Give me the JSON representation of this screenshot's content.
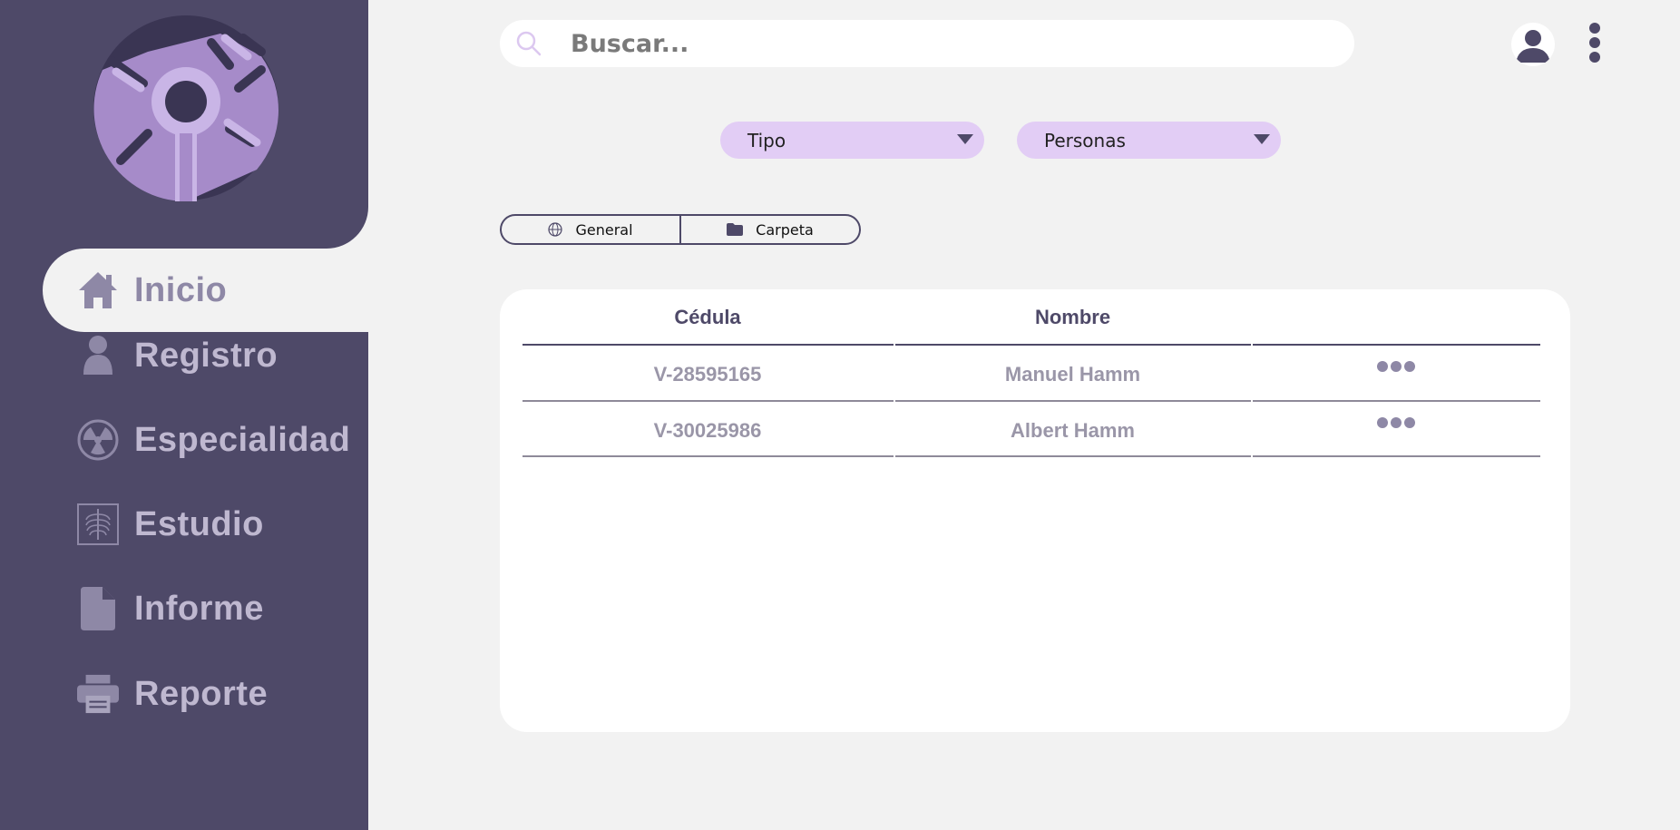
{
  "sidebar": {
    "items": [
      {
        "label": "Inicio",
        "icon": "home-icon",
        "active": true
      },
      {
        "label": "Registro",
        "icon": "user-icon"
      },
      {
        "label": "Especialidad",
        "icon": "radiation-icon"
      },
      {
        "label": "Estudio",
        "icon": "xray-icon"
      },
      {
        "label": "Informe",
        "icon": "document-icon"
      },
      {
        "label": "Reporte",
        "icon": "printer-icon"
      }
    ]
  },
  "search": {
    "placeholder": "Buscar..."
  },
  "filters": {
    "tipo": "Tipo",
    "personas": "Personas"
  },
  "tabs": [
    {
      "label": "General",
      "icon": "globe-icon"
    },
    {
      "label": "Carpeta",
      "icon": "folder-icon"
    }
  ],
  "table": {
    "headers": [
      "Cédula",
      "Nombre",
      ""
    ],
    "rows": [
      {
        "cedula": "V-28595165",
        "nombre": "Manuel Hamm"
      },
      {
        "cedula": "V-30025986",
        "nombre": "Albert Hamm"
      }
    ]
  },
  "colors": {
    "sidebar": "#4e4968",
    "accent": "#e2cdf5",
    "background": "#f2f2f2"
  }
}
